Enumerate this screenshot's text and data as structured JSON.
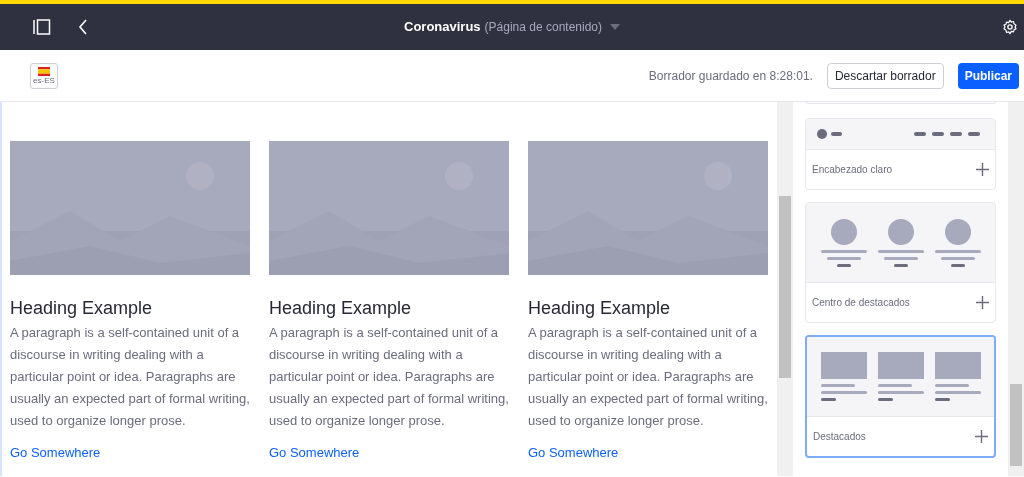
{
  "header": {
    "title": "Coronavirus",
    "subtitle": "(Página de contenido)"
  },
  "toolbar": {
    "locale": "es-ES",
    "status": "Borrador guardado en 8:28:01.",
    "discard_button": "Descartar borrador",
    "publish_button": "Publicar"
  },
  "cards": [
    {
      "heading": "Heading Example",
      "text": "A paragraph is a self-contained unit of a discourse in writing dealing with a particular point or idea. Paragraphs are usually an expected part of formal writing, used to organize longer prose.",
      "link": "Go Somewhere"
    },
    {
      "heading": "Heading Example",
      "text": "A paragraph is a self-contained unit of a discourse in writing dealing with a particular point or idea. Paragraphs are usually an expected part of formal writing, used to organize longer prose.",
      "link": "Go Somewhere"
    },
    {
      "heading": "Heading Example",
      "text": "A paragraph is a self-contained unit of a discourse in writing dealing with a particular point or idea. Paragraphs are usually an expected part of formal writing, used to organize longer prose.",
      "link": "Go Somewhere"
    }
  ],
  "sidebar": {
    "fragments": [
      {
        "kind": "header",
        "label": "Encabezado claro",
        "selected": false
      },
      {
        "kind": "circles",
        "label": "Centro de destacados",
        "selected": false
      },
      {
        "kind": "blocks",
        "label": "Destacados",
        "selected": true
      }
    ]
  }
}
